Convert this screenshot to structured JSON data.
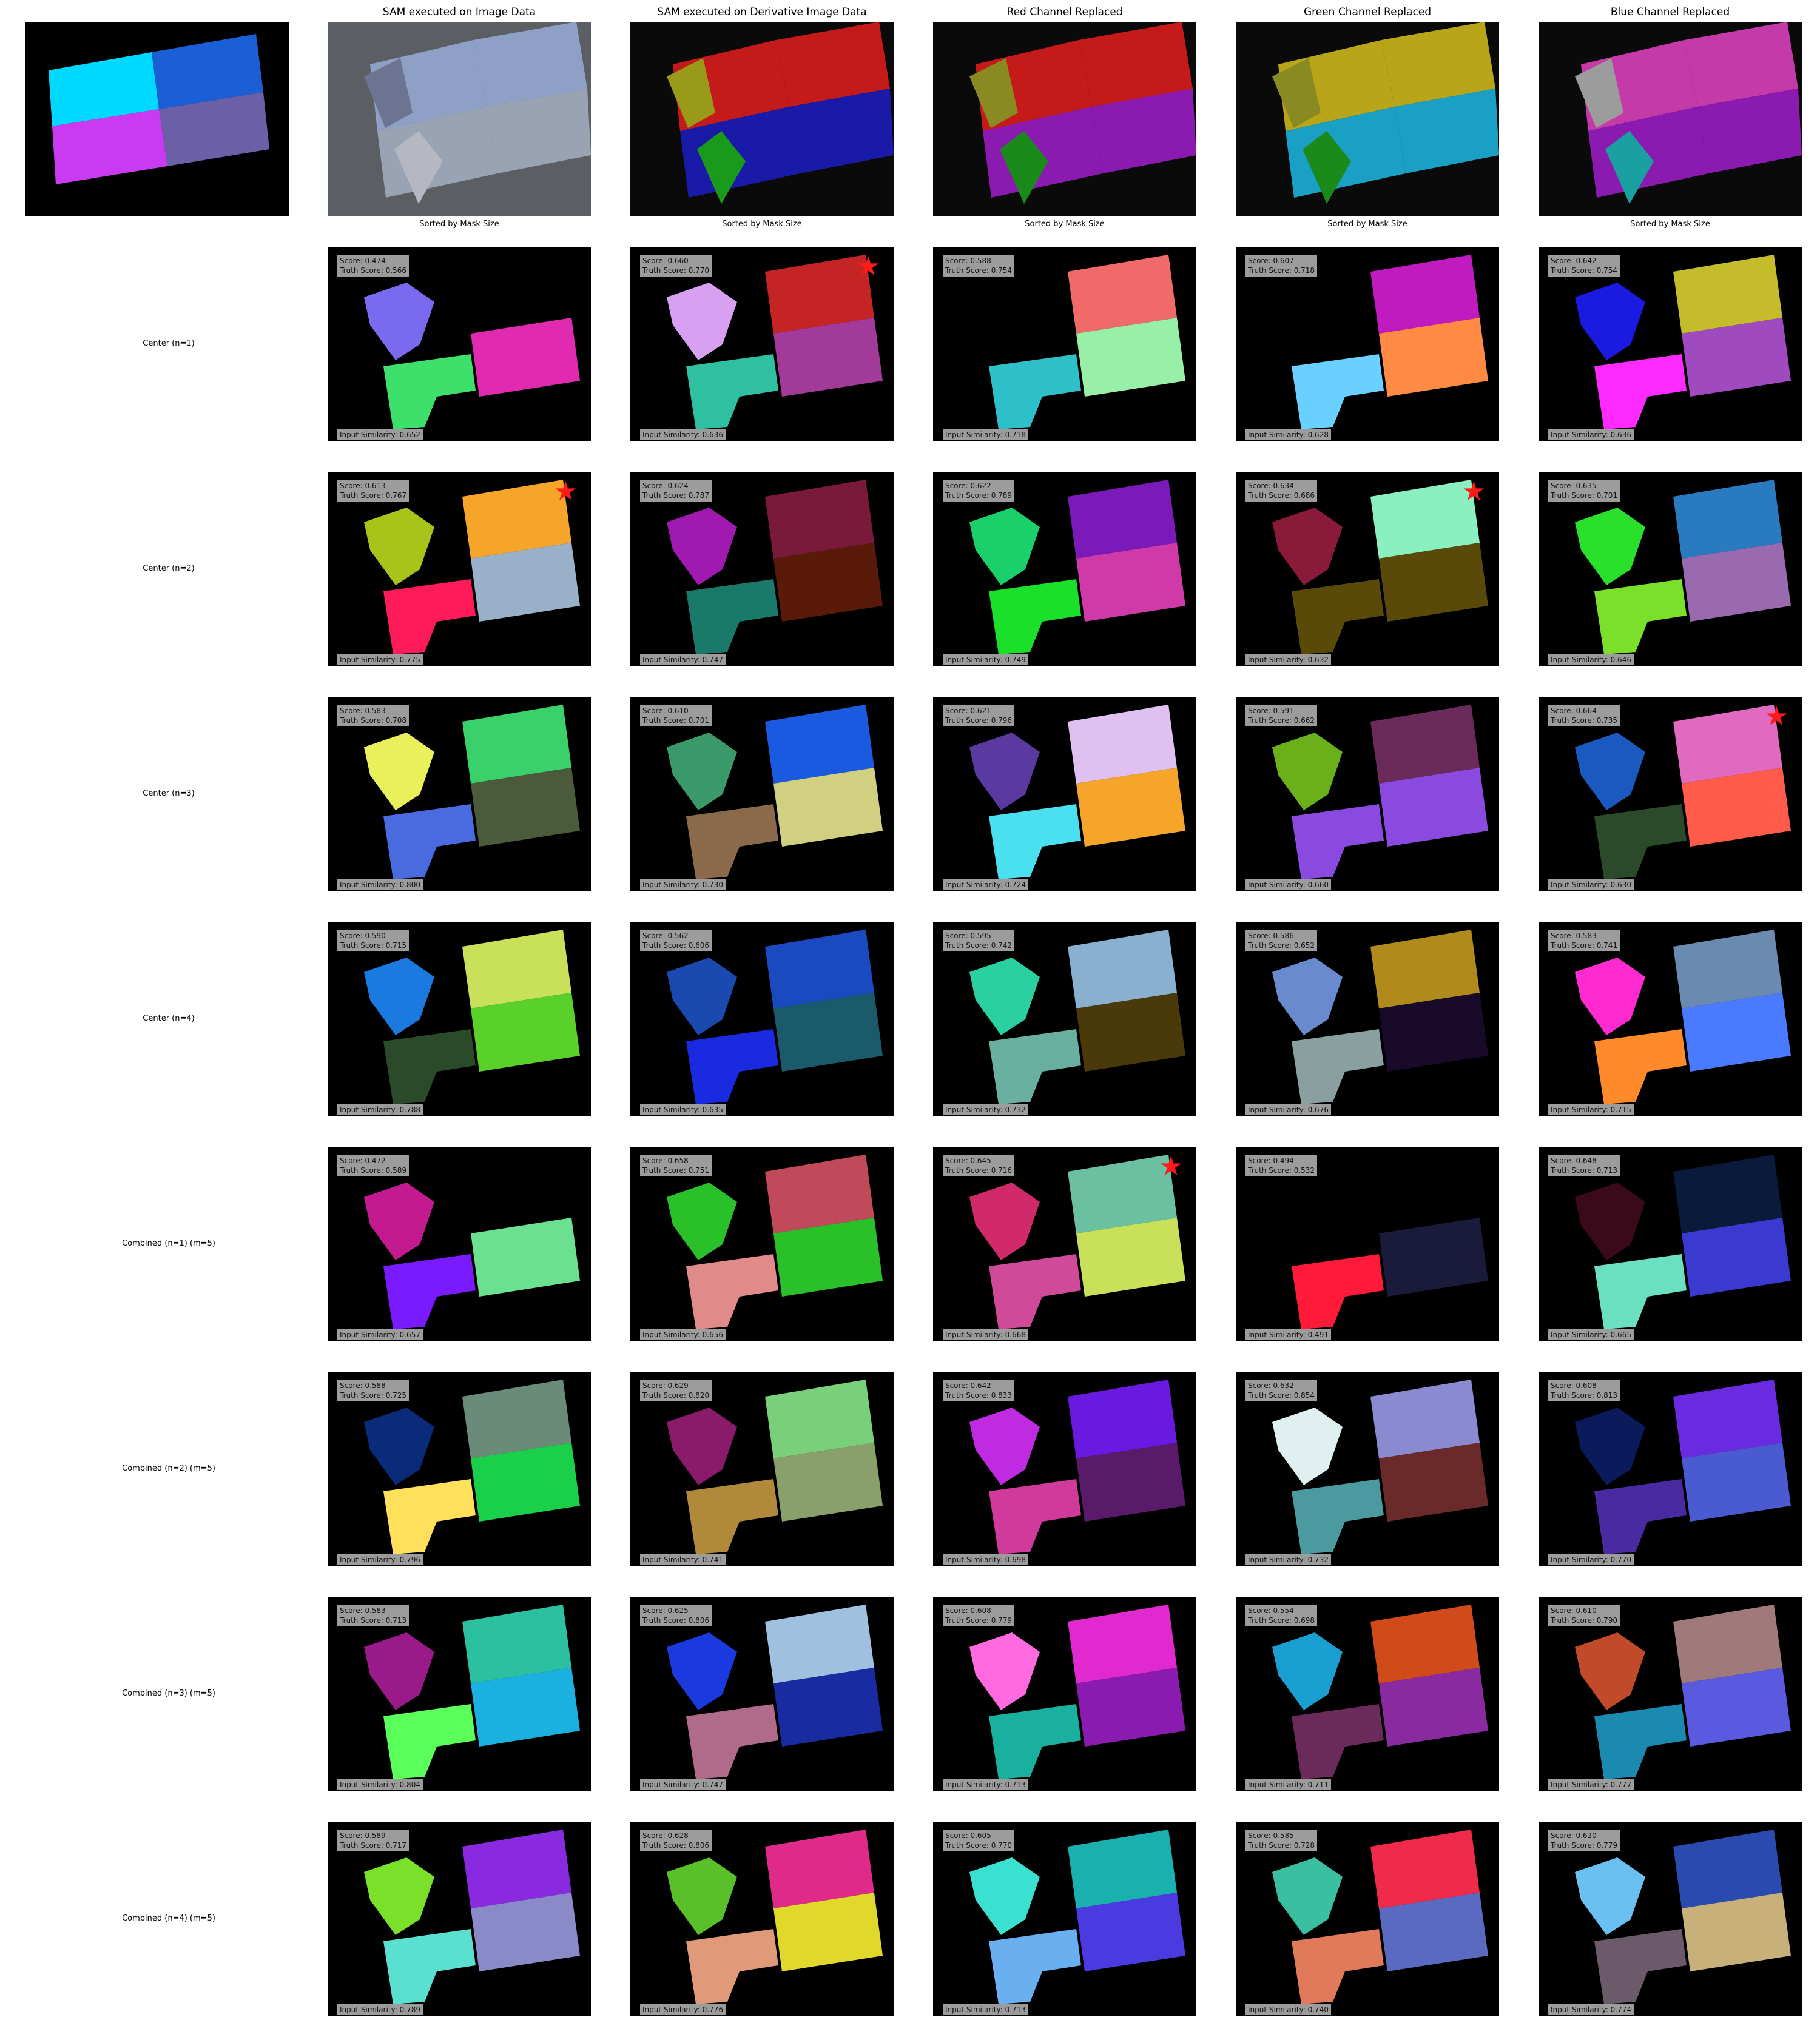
{
  "column_titles": [
    "SAM executed on Image Data",
    "SAM executed on Derivative Image Data",
    "Red Channel Replaced",
    "Green Channel Replaced",
    "Blue Channel Replaced"
  ],
  "sub_label": "Sorted by Mask Size",
  "ground_truth_colors": [
    "#00d9ff",
    "#1a5fd6",
    "#c93af0",
    "#6b5fa8"
  ],
  "header_colors": [
    [
      "#8fa0c7",
      "#9aa3b3",
      "#6c7491",
      "#b5b8c2"
    ],
    [
      "#c41a1a",
      "#1a1aa8",
      "#9a9a1a",
      "#1a9a1a"
    ],
    [
      "#c41a1a",
      "#8a1ab0",
      "#8a8a22",
      "#1a8a1a"
    ],
    [
      "#b8a51a",
      "#1aa0c4",
      "#8a8a22",
      "#1a8a1a"
    ],
    [
      "#c43aa8",
      "#8a1ab0",
      "#9c9c9c",
      "#1aa0a0"
    ]
  ],
  "rows": [
    {
      "label": "Center (n=1)",
      "cells": [
        {
          "score": "Score: 0.474",
          "truth": "Truth Score: 0.566",
          "similarity": "Input Similarity: 0.652",
          "star": false,
          "colors": [
            "#000000",
            "#e02ab0",
            "#7a6af0",
            "#3ce06a"
          ]
        },
        {
          "score": "Score: 0.660",
          "truth": "Truth Score: 0.770",
          "similarity": "Input Similarity: 0.636",
          "star": true,
          "colors": [
            "#c42424",
            "#a23a9a",
            "#d8a0f0",
            "#2ec0a0"
          ]
        },
        {
          "score": "Score: 0.588",
          "truth": "Truth Score: 0.754",
          "similarity": "Input Similarity: 0.718",
          "star": false,
          "colors": [
            "#f06a6a",
            "#98f0a8",
            "#000000",
            "#2ec0c8"
          ]
        },
        {
          "score": "Score: 0.607",
          "truth": "Truth Score: 0.718",
          "similarity": "Input Similarity: 0.628",
          "star": false,
          "colors": [
            "#c01ac0",
            "#ff8a44",
            "#000000",
            "#6ad0ff"
          ]
        },
        {
          "score": "Score: 0.642",
          "truth": "Truth Score: 0.754",
          "similarity": "Input Similarity: 0.636",
          "star": false,
          "colors": [
            "#c4bc2a",
            "#a04ac0",
            "#1a1ae0",
            "#ff2aff"
          ]
        }
      ]
    },
    {
      "label": "Center (n=2)",
      "cells": [
        {
          "score": "Score: 0.613",
          "truth": "Truth Score: 0.767",
          "similarity": "Input Similarity: 0.775",
          "star": true,
          "colors": [
            "#f5a52a",
            "#98b0c8",
            "#a8c41a",
            "#ff1a5a"
          ]
        },
        {
          "score": "Score: 0.624",
          "truth": "Truth Score: 0.787",
          "similarity": "Input Similarity: 0.747",
          "star": false,
          "colors": [
            "#7a1a3a",
            "#5a1a0a",
            "#a01ab0",
            "#1a7a6a"
          ]
        },
        {
          "score": "Score: 0.622",
          "truth": "Truth Score: 0.789",
          "similarity": "Input Similarity: 0.749",
          "star": false,
          "colors": [
            "#7a1ab8",
            "#d03aa8",
            "#1ad06a",
            "#1ae02a"
          ]
        },
        {
          "score": "Score: 0.634",
          "truth": "Truth Score: 0.686",
          "similarity": "Input Similarity: 0.632",
          "star": true,
          "colors": [
            "#8af0c0",
            "#5a4a0a",
            "#8a1a3a",
            "#5a4a0a"
          ]
        },
        {
          "score": "Score: 0.635",
          "truth": "Truth Score: 0.701",
          "similarity": "Input Similarity: 0.646",
          "star": false,
          "colors": [
            "#2a7ac0",
            "#9a6ab0",
            "#2ae02a",
            "#7ae02a"
          ]
        }
      ]
    },
    {
      "label": "Center (n=3)",
      "cells": [
        {
          "score": "Score: 0.583",
          "truth": "Truth Score: 0.708",
          "similarity": "Input Similarity: 0.800",
          "star": false,
          "colors": [
            "#3ad06a",
            "#4a5a3a",
            "#eaf05a",
            "#4a6ae0"
          ]
        },
        {
          "score": "Score: 0.610",
          "truth": "Truth Score: 0.701",
          "similarity": "Input Similarity: 0.730",
          "star": false,
          "colors": [
            "#1a5ae0",
            "#d0d080",
            "#3a9a6a",
            "#8a6a4a"
          ]
        },
        {
          "score": "Score: 0.621",
          "truth": "Truth Score: 0.796",
          "similarity": "Input Similarity: 0.724",
          "star": false,
          "colors": [
            "#e0c0f0",
            "#f5a52a",
            "#5a3aa0",
            "#4ae0f0"
          ]
        },
        {
          "score": "Score: 0.591",
          "truth": "Truth Score: 0.662",
          "similarity": "Input Similarity: 0.660",
          "star": false,
          "colors": [
            "#6a2a5a",
            "#8a4ae0",
            "#6ab01a",
            "#8a4ae0"
          ]
        },
        {
          "score": "Score: 0.664",
          "truth": "Truth Score: 0.735",
          "similarity": "Input Similarity: 0.630",
          "star": true,
          "colors": [
            "#e06ac0",
            "#ff5a4a",
            "#1a5ac0",
            "#2a4a2a"
          ]
        }
      ]
    },
    {
      "label": "Center (n=4)",
      "cells": [
        {
          "score": "Score: 0.590",
          "truth": "Truth Score: 0.715",
          "similarity": "Input Similarity: 0.788",
          "star": false,
          "colors": [
            "#c8e05a",
            "#5ad02a",
            "#1a7ae0",
            "#2a4a2a"
          ]
        },
        {
          "score": "Score: 0.562",
          "truth": "Truth Score: 0.606",
          "similarity": "Input Similarity: 0.635",
          "star": false,
          "colors": [
            "#1a4ac0",
            "#1a5a6a",
            "#1a4ab0",
            "#1a2ae0"
          ]
        },
        {
          "score": "Score: 0.595",
          "truth": "Truth Score: 0.742",
          "similarity": "Input Similarity: 0.732",
          "star": false,
          "colors": [
            "#8ab0d0",
            "#4a3a0a",
            "#2ad0a0",
            "#6ab0a0"
          ]
        },
        {
          "score": "Score: 0.586",
          "truth": "Truth Score: 0.652",
          "similarity": "Input Similarity: 0.676",
          "star": false,
          "colors": [
            "#b08a1a",
            "#1a0a2a",
            "#6a8ad0",
            "#8aa0a0"
          ]
        },
        {
          "score": "Score: 0.583",
          "truth": "Truth Score: 0.741",
          "similarity": "Input Similarity: 0.715",
          "star": false,
          "colors": [
            "#6a8ab0",
            "#4a7aff",
            "#ff2ad0",
            "#ff8a2a"
          ]
        }
      ]
    },
    {
      "label": "Combined (n=1) (m=5)",
      "cells": [
        {
          "score": "Score: 0.472",
          "truth": "Truth Score: 0.589",
          "similarity": "Input Similarity: 0.657",
          "star": false,
          "colors": [
            "#000000",
            "#6ae090",
            "#c41a90",
            "#7a1aff"
          ]
        },
        {
          "score": "Score: 0.658",
          "truth": "Truth Score: 0.751",
          "similarity": "Input Similarity: 0.656",
          "star": false,
          "colors": [
            "#c04a5a",
            "#2ac02a",
            "#2ac02a",
            "#e08a8a"
          ]
        },
        {
          "score": "Score: 0.645",
          "truth": "Truth Score: 0.716",
          "similarity": "Input Similarity: 0.668",
          "star": true,
          "colors": [
            "#6ac0a0",
            "#c8e05a",
            "#d02a6a",
            "#d04a9a"
          ]
        },
        {
          "score": "Score: 0.494",
          "truth": "Truth Score: 0.532",
          "similarity": "Input Similarity: 0.491",
          "star": false,
          "colors": [
            "#000000",
            "#1a1a3a",
            "#000000",
            "#ff1a3a"
          ]
        },
        {
          "score": "Score: 0.648",
          "truth": "Truth Score: 0.713",
          "similarity": "Input Similarity: 0.665",
          "star": false,
          "colors": [
            "#0a1a3a",
            "#3a3ad0",
            "#3a0a1a",
            "#6ae0c0"
          ]
        }
      ]
    },
    {
      "label": "Combined (n=2) (m=5)",
      "cells": [
        {
          "score": "Score: 0.588",
          "truth": "Truth Score: 0.725",
          "similarity": "Input Similarity: 0.796",
          "star": false,
          "colors": [
            "#6a8a7a",
            "#1ad04a",
            "#0a2a7a",
            "#ffe05a"
          ]
        },
        {
          "score": "Score: 0.629",
          "truth": "Truth Score: 0.820",
          "similarity": "Input Similarity: 0.741",
          "star": false,
          "colors": [
            "#7ad07a",
            "#8aa06a",
            "#8a1a6a",
            "#b08a3a"
          ]
        },
        {
          "score": "Score: 0.642",
          "truth": "Truth Score: 0.833",
          "similarity": "Input Similarity: 0.698",
          "star": false,
          "colors": [
            "#6a1ae0",
            "#5a1a6a",
            "#c02ae0",
            "#d03a9a"
          ]
        },
        {
          "score": "Score: 0.632",
          "truth": "Truth Score: 0.854",
          "similarity": "Input Similarity: 0.732",
          "star": false,
          "colors": [
            "#8a8ad0",
            "#6a2a2a",
            "#e0f0f0",
            "#4a9aa0"
          ]
        },
        {
          "score": "Score: 0.608",
          "truth": "Truth Score: 0.813",
          "similarity": "Input Similarity: 0.770",
          "star": false,
          "colors": [
            "#6a2ae0",
            "#4a5ad0",
            "#0a1a5a",
            "#4a2aa0"
          ]
        }
      ]
    },
    {
      "label": "Combined (n=3) (m=5)",
      "cells": [
        {
          "score": "Score: 0.583",
          "truth": "Truth Score: 0.713",
          "similarity": "Input Similarity: 0.804",
          "star": false,
          "colors": [
            "#2ac0a0",
            "#1ab0e0",
            "#9a1a8a",
            "#5aff5a"
          ]
        },
        {
          "score": "Score: 0.625",
          "truth": "Truth Score: 0.806",
          "similarity": "Input Similarity: 0.747",
          "star": false,
          "colors": [
            "#a0c0e0",
            "#1a2aa0",
            "#1a3ae0",
            "#b06a8a"
          ]
        },
        {
          "score": "Score: 0.608",
          "truth": "Truth Score: 0.779",
          "similarity": "Input Similarity: 0.713",
          "star": false,
          "colors": [
            "#e02ad0",
            "#8a1ab0",
            "#ff6ae0",
            "#1ab0a0"
          ]
        },
        {
          "score": "Score: 0.554",
          "truth": "Truth Score: 0.698",
          "similarity": "Input Similarity: 0.711",
          "star": false,
          "colors": [
            "#d04a1a",
            "#8a2aa0",
            "#1aa0d0",
            "#6a2a5a"
          ]
        },
        {
          "score": "Score: 0.610",
          "truth": "Truth Score: 0.790",
          "similarity": "Input Similarity: 0.777",
          "star": false,
          "colors": [
            "#a07a7a",
            "#5a5ae0",
            "#c04a2a",
            "#1a8ab0"
          ]
        }
      ]
    },
    {
      "label": "Combined (n=4) (m=5)",
      "cells": [
        {
          "score": "Score: 0.589",
          "truth": "Truth Score: 0.717",
          "similarity": "Input Similarity: 0.789",
          "star": false,
          "colors": [
            "#8a2ae0",
            "#8a8ac8",
            "#7ae02a",
            "#5ae0d0"
          ]
        },
        {
          "score": "Score: 0.628",
          "truth": "Truth Score: 0.806",
          "similarity": "Input Similarity: 0.776",
          "star": false,
          "colors": [
            "#e02a8a",
            "#e0d82a",
            "#5ac02a",
            "#e09a7a"
          ]
        },
        {
          "score": "Score: 0.605",
          "truth": "Truth Score: 0.770",
          "similarity": "Input Similarity: 0.713",
          "star": false,
          "colors": [
            "#1ab0b0",
            "#4a3ae0",
            "#3ae0d0",
            "#6ab0f0"
          ]
        },
        {
          "score": "Score: 0.585",
          "truth": "Truth Score: 0.728",
          "similarity": "Input Similarity: 0.740",
          "star": false,
          "colors": [
            "#f02a4a",
            "#5a6ac0",
            "#3ac0a0",
            "#e07a5a"
          ]
        },
        {
          "score": "Score: 0.620",
          "truth": "Truth Score: 0.779",
          "similarity": "Input Similarity: 0.774",
          "star": false,
          "colors": [
            "#2a4ab0",
            "#c8b07a",
            "#6ac0f0",
            "#6a5a6a"
          ]
        }
      ]
    }
  ]
}
